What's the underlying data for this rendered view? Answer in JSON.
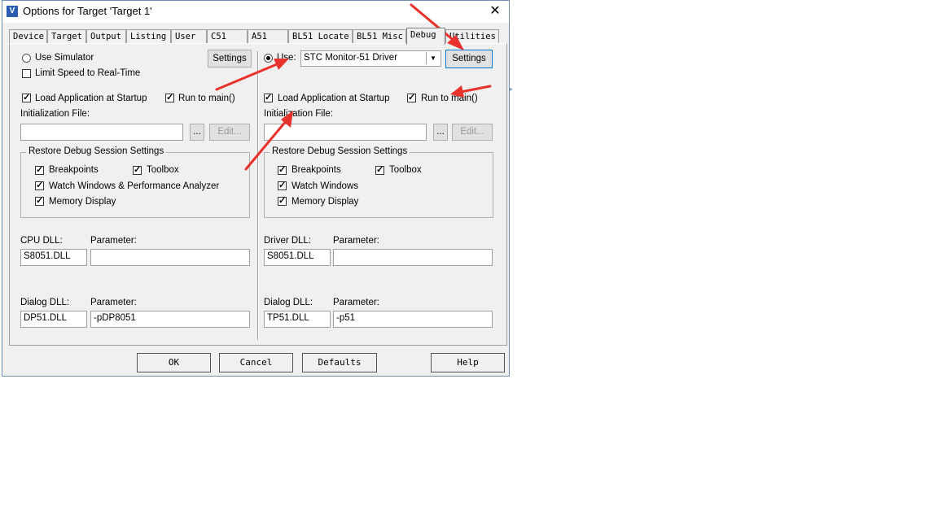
{
  "window": {
    "title": "Options for Target 'Target 1'",
    "app_icon_glyph": "V",
    "close_glyph": "✕"
  },
  "tabs": [
    "Device",
    "Target",
    "Output",
    "Listing",
    "User",
    "C51",
    "A51",
    "BL51 Locate",
    "BL51 Misc",
    "Debug",
    "Utilities"
  ],
  "active_tab": "Debug",
  "left": {
    "use_simulator": "Use Simulator",
    "limit_speed": "Limit Speed to Real-Time",
    "settings": "Settings",
    "load_app": "Load Application at Startup",
    "run_to_main": "Run to main()",
    "init_file_label": "Initialization File:",
    "init_file_value": "",
    "browse": "...",
    "edit": "Edit...",
    "restore_title": "Restore Debug Session Settings",
    "breakpoints": "Breakpoints",
    "toolbox": "Toolbox",
    "watch": "Watch Windows & Performance Analyzer",
    "memory": "Memory Display",
    "cpu_dll_label": "CPU DLL:",
    "cpu_param_label": "Parameter:",
    "cpu_dll": "S8051.DLL",
    "cpu_param": "",
    "dialog_dll_label": "Dialog DLL:",
    "dialog_param_label": "Parameter:",
    "dialog_dll": "DP51.DLL",
    "dialog_param": "-pDP8051"
  },
  "right": {
    "use": "Use:",
    "driver": "STC Monitor-51 Driver",
    "settings": "Settings",
    "load_app": "Load Application at Startup",
    "run_to_main": "Run to main()",
    "init_file_label": "Initialization File:",
    "init_file_value": "",
    "browse": "...",
    "edit": "Edit...",
    "restore_title": "Restore Debug Session Settings",
    "breakpoints": "Breakpoints",
    "toolbox": "Toolbox",
    "watch": "Watch Windows",
    "memory": "Memory Display",
    "driver_dll_label": "Driver DLL:",
    "driver_param_label": "Parameter:",
    "driver_dll": "S8051.DLL",
    "driver_param": "",
    "dialog_dll_label": "Dialog DLL:",
    "dialog_param_label": "Parameter:",
    "dialog_dll": "TP51.DLL",
    "dialog_param": "-p51"
  },
  "footer": {
    "ok": "OK",
    "cancel": "Cancel",
    "defaults": "Defaults",
    "help": "Help"
  },
  "annotation_color": "#e8322b"
}
